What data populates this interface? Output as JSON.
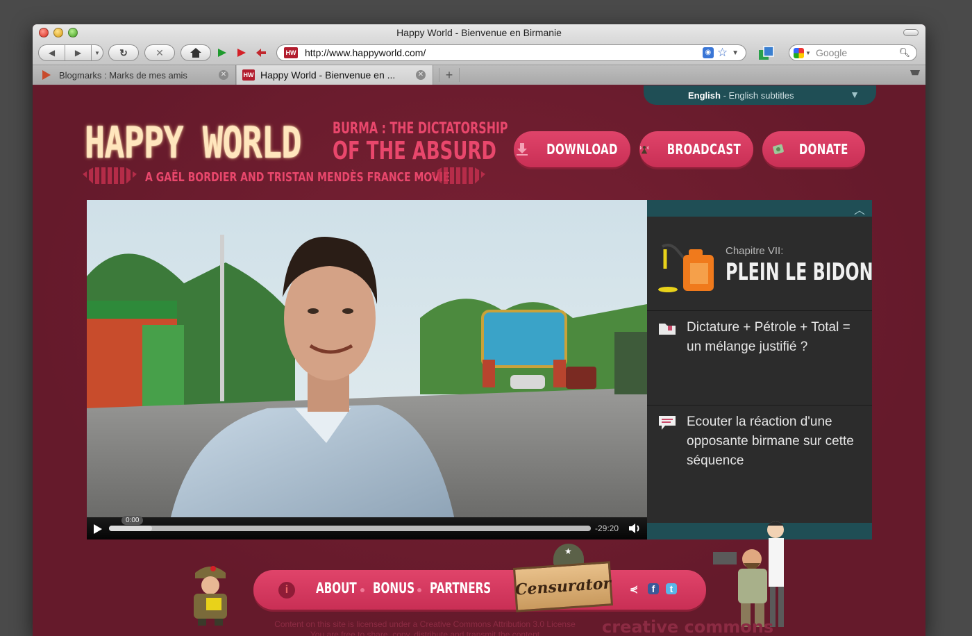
{
  "browser": {
    "window_title": "Happy World - Bienvenue en Birmanie",
    "url": "http://www.happyworld.com/",
    "favicon_text": "HW",
    "search_placeholder": "Google",
    "tabs": [
      {
        "label": "Blogmarks : Marks de mes amis",
        "active": false
      },
      {
        "label": "Happy World - Bienvenue en ...",
        "active": true
      }
    ],
    "new_tab_label": "+"
  },
  "language_bar": {
    "language": "English",
    "subtitle_info": " - English subtitles"
  },
  "logo": {
    "main": "HAPPY WORLD",
    "line1": "BURMA : THE DICTATORSHIP",
    "line2": "OF THE ABSURD",
    "credit": "A GAËL BORDIER AND TRISTAN MENDÈS FRANCE MOVIE"
  },
  "actions": {
    "download": "DOWNLOAD",
    "broadcast": "BROADCAST",
    "donate": "DONATE"
  },
  "player": {
    "current_time": "0:00",
    "remaining_time": "-29:20",
    "progress": 0.09
  },
  "sidebar": {
    "chapter_label": "Chapitre VII:",
    "chapter_title": "PLEIN LE BIDON",
    "items": [
      {
        "text": "Dictature + Pétrole + Total = un mélange justifié ?"
      },
      {
        "text": "Ecouter la réaction d'une opposante birmane sur cette séquence"
      }
    ]
  },
  "footer": {
    "links": [
      "ABOUT",
      "BONUS",
      "PARTNERS"
    ],
    "censor_label": "Censurator",
    "license_line1": "Content on this site is licensed under a Creative Commons Attribution 3.0 License",
    "license_line2": "You are free to share, copy, distribute and transmit the content",
    "cc_text": "creative commons"
  },
  "colors": {
    "page_bg": "#6b1f30",
    "accent_pink": "#d83a60",
    "teal": "#1f4e55",
    "panel": "#2c2c2c"
  }
}
